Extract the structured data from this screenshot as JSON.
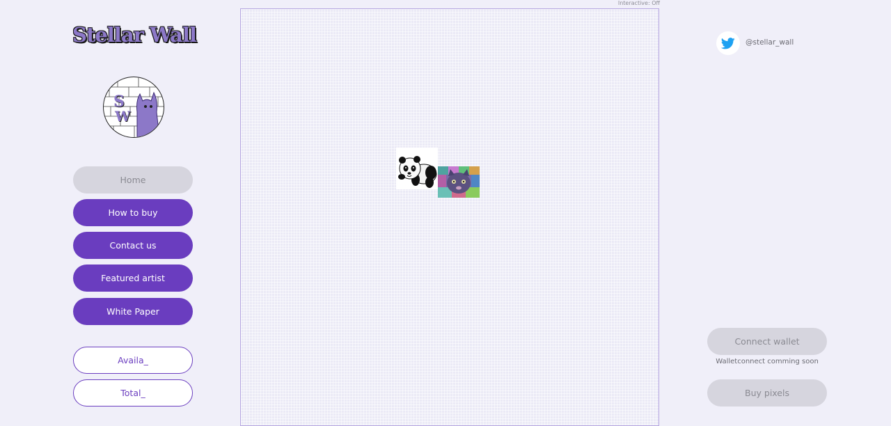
{
  "brand": {
    "logo_text": "Stellar Wall",
    "avatar_letters": [
      "S",
      "W"
    ]
  },
  "nav": {
    "home": "Home",
    "how_to_buy": "How to buy",
    "contact_us": "Contact us",
    "featured_artist": "Featured artist",
    "white_paper": "White Paper"
  },
  "stats": {
    "available": "Availa_",
    "total": "Total_"
  },
  "canvas": {
    "interactive_status": "Interactive: Off",
    "tiles": [
      {
        "name": "panda-image",
        "kind": "panda"
      },
      {
        "name": "psychedelic-cat-image",
        "kind": "psychedelic"
      }
    ]
  },
  "social": {
    "icon": "twitter-icon",
    "handle": "@stellar_wall"
  },
  "wallet": {
    "connect_label": "Connect wallet",
    "note": "Walletconnect comming soon",
    "buy_label": "Buy pixels"
  },
  "colors": {
    "primary": "#6a3dbf",
    "disabled": "#d6d5de",
    "background": "#f0eff9",
    "twitter": "#1da1f2"
  }
}
